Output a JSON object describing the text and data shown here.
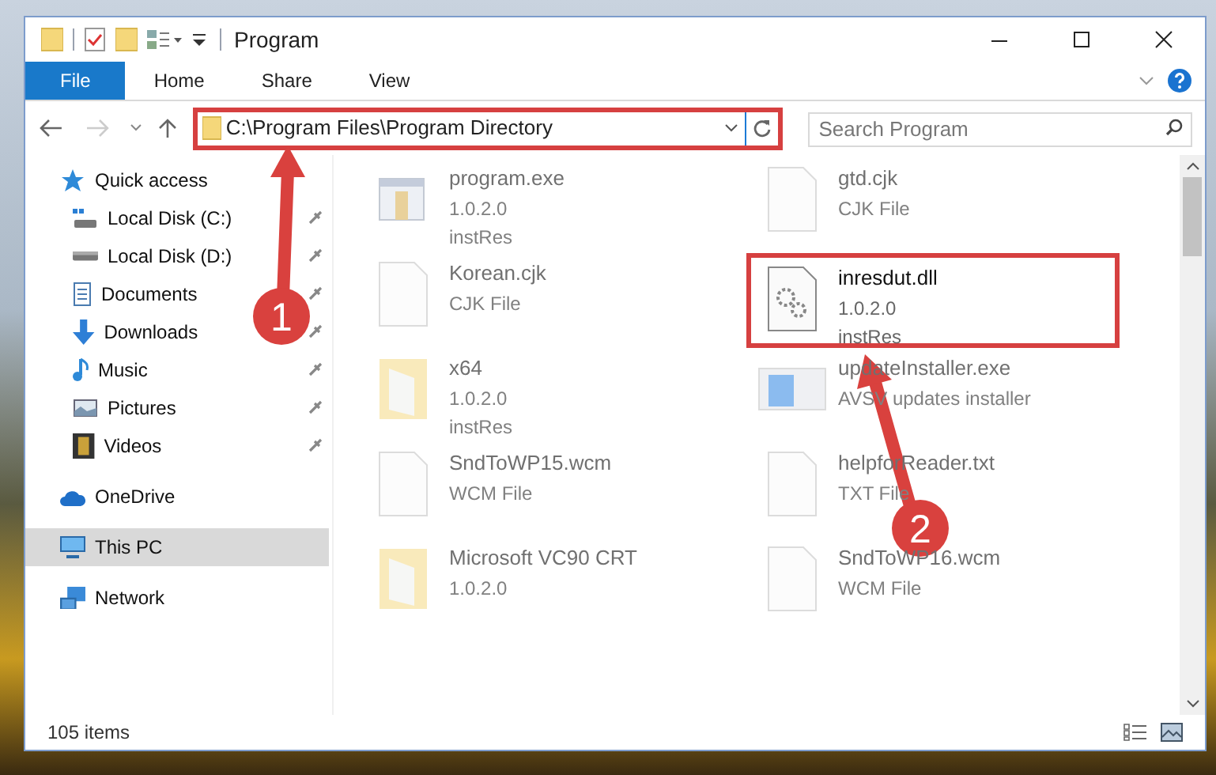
{
  "window": {
    "title": "Program"
  },
  "ribbon_tabs": [
    {
      "label": "File",
      "selected": true
    },
    {
      "label": "Home",
      "selected": false
    },
    {
      "label": "Share",
      "selected": false
    },
    {
      "label": "View",
      "selected": false
    }
  ],
  "address": {
    "value": "C:\\Program Files\\Program Directory",
    "highlighted": true
  },
  "search": {
    "placeholder": "Search Program"
  },
  "sidebar": {
    "items": [
      {
        "label": "Quick access",
        "selected": false,
        "children": [
          {
            "label": "Local Disk (C:)",
            "pinned": true,
            "selected": false
          },
          {
            "label": "Local Disk (D:)",
            "pinned": true,
            "selected": false
          },
          {
            "label": "Documents",
            "pinned": true,
            "selected": false
          },
          {
            "label": "Downloads",
            "pinned": true,
            "selected": false
          },
          {
            "label": "Music",
            "pinned": true,
            "selected": false
          },
          {
            "label": "Pictures",
            "pinned": true,
            "selected": false
          },
          {
            "label": "Videos",
            "pinned": true,
            "selected": false
          }
        ]
      },
      {
        "label": "OneDrive",
        "selected": false
      },
      {
        "label": "This PC",
        "selected": true
      },
      {
        "label": "Network",
        "selected": false
      }
    ]
  },
  "files": [
    {
      "kind": "exe",
      "name": "program.exe",
      "lines": [
        "1.0.2.0",
        "instRes"
      ],
      "highlighted": false
    },
    {
      "kind": "doc",
      "name": "gtd.cjk",
      "lines": [
        "CJK File"
      ],
      "highlighted": false
    },
    {
      "kind": "doc",
      "name": "Korean.cjk",
      "lines": [
        "CJK File"
      ],
      "highlighted": false
    },
    {
      "kind": "dll",
      "name": "inresdut.dll",
      "lines": [
        "1.0.2.0",
        "instRes"
      ],
      "highlighted": true
    },
    {
      "kind": "folder",
      "name": "x64",
      "lines": [
        "1.0.2.0",
        "instRes"
      ],
      "highlighted": false
    },
    {
      "kind": "installer",
      "name": "updateInstaller.exe",
      "lines": [
        "AVSV updates installer"
      ],
      "highlighted": false
    },
    {
      "kind": "doc",
      "name": "SndToWP15.wcm",
      "lines": [
        "WCM File"
      ],
      "highlighted": false
    },
    {
      "kind": "doc",
      "name": "helpforReader.txt",
      "lines": [
        "TXT File"
      ],
      "highlighted": false
    },
    {
      "kind": "folder",
      "name": "Microsoft VC90 CRT",
      "lines": [
        "1.0.2.0"
      ],
      "highlighted": false
    },
    {
      "kind": "doc",
      "name": "SndToWP16.wcm",
      "lines": [
        "WCM File"
      ],
      "highlighted": false
    }
  ],
  "callouts": [
    {
      "label": "1"
    },
    {
      "label": "2"
    }
  ],
  "status_bar": {
    "count": "105 items"
  }
}
